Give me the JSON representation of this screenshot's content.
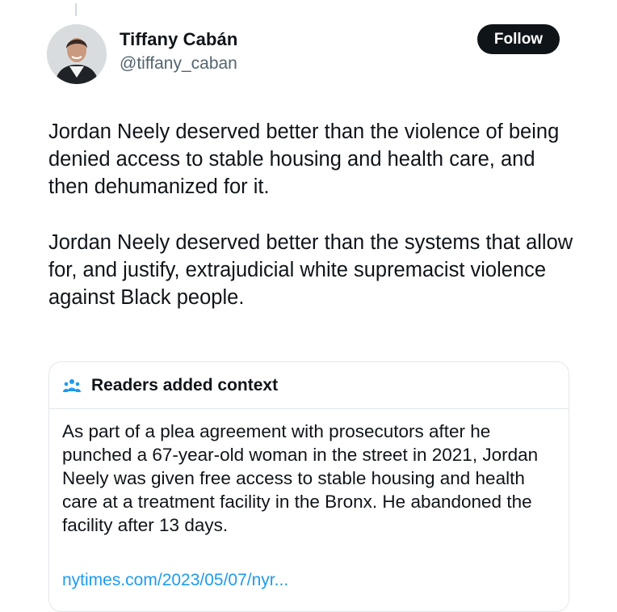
{
  "author": {
    "name": "Tiffany Cabán",
    "handle": "@tiffany_caban"
  },
  "follow_button": {
    "label": "Follow"
  },
  "tweet": {
    "paragraphs": [
      "Jordan Neely deserved better than the violence of being denied access to stable housing and health care, and then dehumanized for it.",
      "Jordan Neely deserved better than the systems that allow for, and justify, extrajudicial white supremacist violence against Black people."
    ]
  },
  "community_note": {
    "title": "Readers added context",
    "icon": "people-group-icon",
    "body": "As part of a plea agreement with prosecutors after he punched a  67-year-old woman in the street in 2021, Jordan Neely was given free access to stable housing and health care at a treatment facility in the Bronx. He abandoned the facility after 13 days.",
    "link": "nytimes.com/2023/05/07/nyr..."
  },
  "colors": {
    "text": "#0f1419",
    "muted": "#536471",
    "link": "#1d9bf0",
    "border": "#e3e8eb",
    "button_bg": "#0f1419"
  }
}
